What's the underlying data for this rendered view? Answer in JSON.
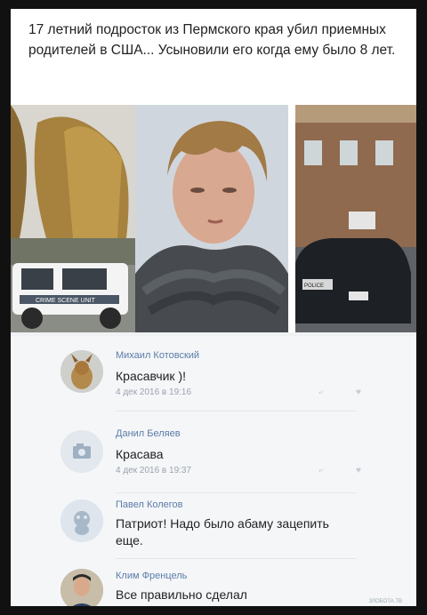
{
  "headline": "17 летний подросток из Пермского края убил приемных родителей в США... Усыновили его когда ему было 8 лет.",
  "photo_labels": [
    "CRIME SCENE UNIT",
    "POLICE"
  ],
  "comments": [
    {
      "name": "Михаил Котовский",
      "text": "Красавчик )!",
      "date": "4 дек 2016 в 19:16"
    },
    {
      "name": "Данил Беляев",
      "text": "Красава",
      "date": "4 дек 2016 в 19:37"
    },
    {
      "name": "Павел Колегов",
      "text": "Патриот! Надо было абаму зацепить еще.",
      "date": ""
    },
    {
      "name": "Клим Френцель",
      "text": "Все правильно сделал",
      "date": ""
    }
  ],
  "icons": {
    "reply": "reply-arrow-icon",
    "like": "heart-icon",
    "camera": "camera-icon",
    "dog": "dog-icon"
  },
  "colors": {
    "name": "#5b7ca8",
    "date": "#9aa3ad",
    "background": "#f5f6f8"
  },
  "watermark": "ЗЛОБОТА.ТВ"
}
